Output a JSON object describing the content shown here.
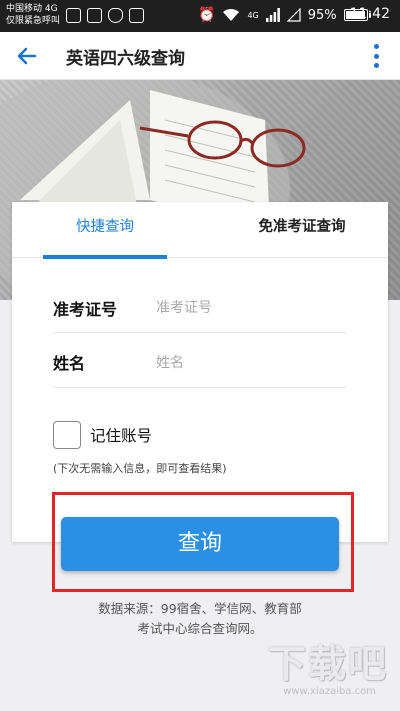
{
  "status_bar": {
    "carrier_line1": "中国移动 4G",
    "carrier_line2": "仅限紧急呼叫",
    "network": "4G",
    "battery": "95%",
    "time": "11:42"
  },
  "app_bar": {
    "title": "英语四六级查询",
    "back_icon": "arrow-left-icon",
    "more_icon": "more-vertical-icon"
  },
  "tabs": [
    {
      "label": "快捷查询",
      "active": true
    },
    {
      "label": "免准考证查询",
      "active": false
    }
  ],
  "form": {
    "ticket": {
      "label": "准考证号",
      "value": "",
      "placeholder": "准考证号"
    },
    "name": {
      "label": "姓名",
      "value": "",
      "placeholder": "姓名"
    },
    "remember": {
      "label": "记住账号",
      "checked": false,
      "hint": "(下次无需输入信息，即可查看结果)"
    }
  },
  "query_button": {
    "label": "查询"
  },
  "footer": {
    "source_line1": "数据来源：99宿舍、学信网、教育部",
    "source_line2": "考试中心综合查询网。"
  },
  "watermark": {
    "text": "下载吧",
    "url": "www.xiazaiba.com"
  },
  "colors": {
    "accent": "#1e7fd8",
    "button": "#2c8fe6",
    "highlight": "#e0262b",
    "status_bar": "#1f1f1f"
  }
}
